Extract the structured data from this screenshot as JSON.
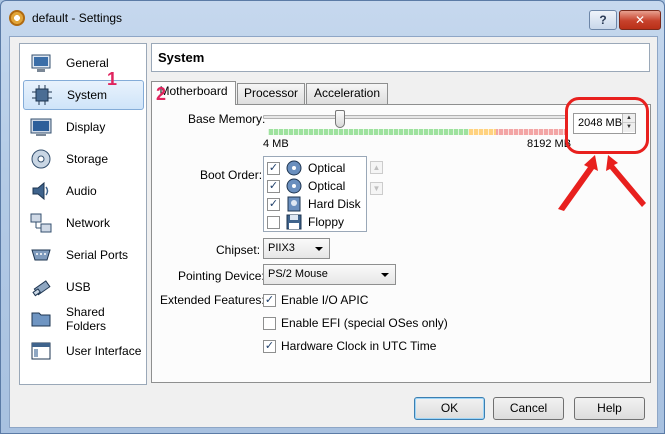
{
  "window": {
    "title": "default - Settings",
    "help_button": "?",
    "close_button": "✕"
  },
  "sidebar": {
    "items": [
      {
        "label": "General",
        "icon": "monitor-icon"
      },
      {
        "label": "System",
        "icon": "chip-icon",
        "selected": true
      },
      {
        "label": "Display",
        "icon": "display-icon"
      },
      {
        "label": "Storage",
        "icon": "disk-icon"
      },
      {
        "label": "Audio",
        "icon": "speaker-icon"
      },
      {
        "label": "Network",
        "icon": "network-icon"
      },
      {
        "label": "Serial Ports",
        "icon": "serial-port-icon"
      },
      {
        "label": "USB",
        "icon": "usb-icon"
      },
      {
        "label": "Shared Folders",
        "icon": "folder-icon"
      },
      {
        "label": "User Interface",
        "icon": "window-icon"
      }
    ]
  },
  "annotations": {
    "step1": "1",
    "step2": "2"
  },
  "section": {
    "title": "System",
    "tabs": [
      {
        "label": "Motherboard",
        "active": true
      },
      {
        "label": "Processor"
      },
      {
        "label": "Acceleration"
      }
    ]
  },
  "motherboard": {
    "base_memory_label": "Base Memory:",
    "memory_min": "4 MB",
    "memory_max": "8192 MB",
    "memory_value": "2048 MB",
    "memory_mb": 2048,
    "boot_order_label": "Boot Order:",
    "boot_items": [
      {
        "label": "Optical",
        "checked": true,
        "icon": "optical-disc-icon"
      },
      {
        "label": "Optical",
        "checked": true,
        "icon": "optical-disc-icon"
      },
      {
        "label": "Hard Disk",
        "checked": true,
        "icon": "hard-disk-icon"
      },
      {
        "label": "Floppy",
        "checked": false,
        "icon": "floppy-icon"
      }
    ],
    "chipset_label": "Chipset:",
    "chipset_value": "PIIX3",
    "pointing_label": "Pointing Device:",
    "pointing_value": "PS/2 Mouse",
    "extended_label": "Extended Features:",
    "features": [
      {
        "label": "Enable I/O APIC",
        "checked": true
      },
      {
        "label": "Enable EFI (special OSes only)",
        "checked": false
      },
      {
        "label": "Hardware Clock in UTC Time",
        "checked": true
      }
    ]
  },
  "buttons": {
    "ok": "OK",
    "cancel": "Cancel",
    "help": "Help"
  },
  "colors": {
    "callout": "#e8201e",
    "step_number": "#e0245e"
  }
}
